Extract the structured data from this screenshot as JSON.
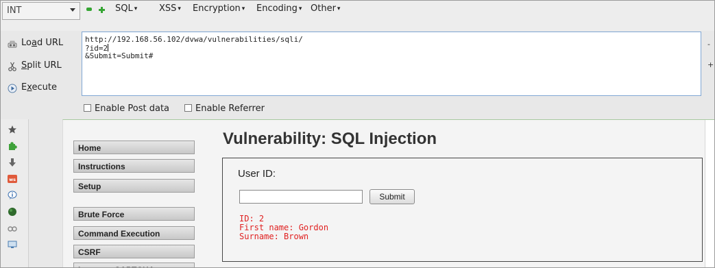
{
  "toolbar": {
    "select_value": "INT",
    "menus": [
      "SQL",
      "XSS",
      "Encryption",
      "Encoding",
      "Other"
    ]
  },
  "actions": {
    "load_url": {
      "pre": "Lo",
      "key": "a",
      "post": "d URL"
    },
    "split_url": {
      "pre": "",
      "key": "S",
      "post": "plit URL"
    },
    "execute": {
      "pre": "E",
      "key": "x",
      "post": "ecute"
    }
  },
  "url": {
    "line1": "http://192.168.56.102/dvwa/vulnerabilities/sqli/",
    "line2": "?id=2",
    "line3": "&Submit=Submit#"
  },
  "options": {
    "post_data": "Enable Post data",
    "referrer": "Enable Referrer"
  },
  "edge_marks": {
    "minus": "-",
    "plus": "+"
  },
  "dvwa": {
    "nav": [
      "Home",
      "Instructions",
      "Setup",
      "Brute Force",
      "Command Execution",
      "CSRF",
      "Insecure CAPTCHA"
    ],
    "page_title": "Vulnerability: SQL Injection",
    "user_id_label": "User ID:",
    "submit_label": "Submit",
    "result": [
      "ID: 2",
      "First name: Gordon",
      "Surname: Brown"
    ]
  },
  "colors": {
    "accent_green": "#35a533",
    "result_red": "#e02020"
  },
  "sidebar_icons": [
    "star-icon",
    "puzzle-icon",
    "download-icon",
    "ws-icon",
    "info-chat-icon",
    "addon-sphere-icon",
    "glasses-icon",
    "monitor-icon"
  ]
}
